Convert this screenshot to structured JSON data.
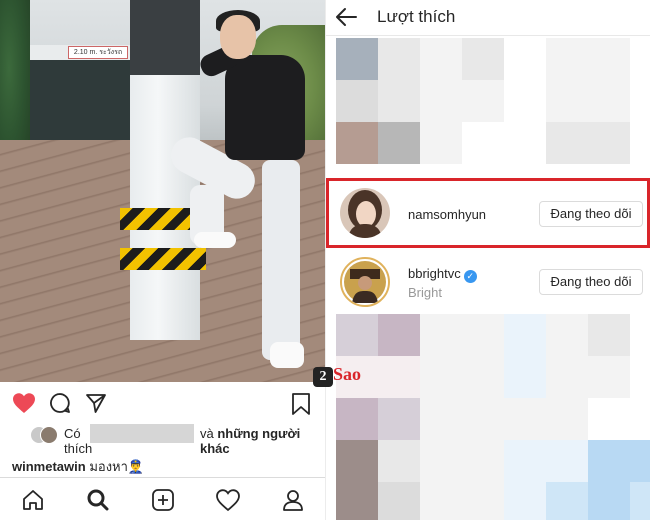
{
  "header": {
    "title": "Lượt thích",
    "back_icon": "back-arrow-icon"
  },
  "likes": [
    {
      "username": "namsomhyun",
      "subtitle": "",
      "verified": false,
      "button": "Đang theo dõi",
      "highlighted": true
    },
    {
      "username": "bbrightvc",
      "subtitle": "Bright",
      "verified": true,
      "button": "Đang theo dõi",
      "highlighted": false
    }
  ],
  "post": {
    "liked_by_prefix": "Có",
    "liked_by_suffix_plain": "và",
    "liked_by_suffix_bold": "những người khác",
    "liked_by_line2": "thích",
    "caption_user": "winmetawin",
    "caption_text": "มองหา👮‍♂️",
    "photo_sign": "2.10 m. ระวังรถ",
    "actions": [
      "heart-filled-icon",
      "comment-icon",
      "share-icon",
      "bookmark-icon"
    ]
  },
  "bottom_nav": [
    "home-icon",
    "search-icon",
    "add-post-icon",
    "activity-heart-icon",
    "profile-icon"
  ],
  "watermark": {
    "num": "2",
    "text": "Sao"
  },
  "colors": {
    "like_red": "#ed4956",
    "highlight_red": "#d9252a",
    "verified_blue": "#3897f0"
  }
}
